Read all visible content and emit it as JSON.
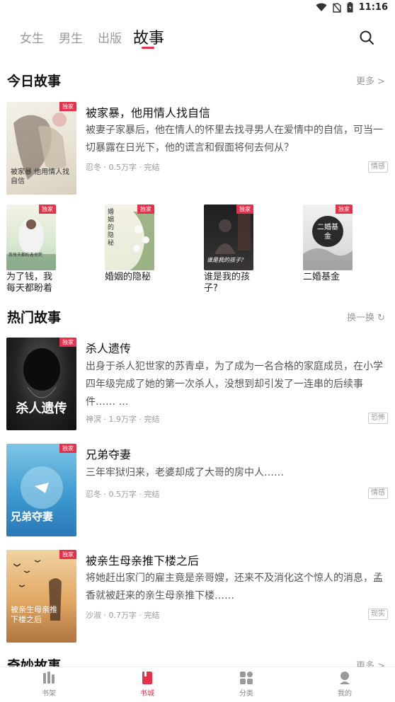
{
  "status_bar": {
    "time": "11:16"
  },
  "top_nav": {
    "tabs": [
      {
        "label": "女生"
      },
      {
        "label": "男生"
      },
      {
        "label": "出版"
      },
      {
        "label": "故事",
        "active": true
      }
    ]
  },
  "sections": {
    "today": {
      "title": "今日故事",
      "action": "更多 >"
    },
    "hot": {
      "title": "热门故事",
      "action": "换一换 ↻"
    },
    "wonder": {
      "title": "奇妙故事",
      "action": "更多 >"
    }
  },
  "badge_label": "独家",
  "featured": {
    "title": "被家暴，他用情人找自信",
    "desc": "被妻子家暴后，他在情人的怀里去找寻男人在爱情中的自信，可当一切暴露在日光下，他的谎言和假面将何去何从？",
    "meta": "忍冬 · 0.5万字 · 完结",
    "tag": "情感",
    "cover_text": "被家暴 他用情人找自信"
  },
  "grid_books": [
    {
      "title": "为了钱，我每天都盼着",
      "cover_text": "我每天都盼着他死"
    },
    {
      "title": "婚姻的隐秘",
      "cover_text": "婚姻的隐秘"
    },
    {
      "title": "谁是我的孩子?",
      "cover_text": "谁是我的孩子?"
    },
    {
      "title": "二婚基金",
      "cover_text": "二婚基金"
    }
  ],
  "hot_books": [
    {
      "title": "杀人遗传",
      "desc": "出身于杀人犯世家的苏青卓，为了成为一名合格的家庭成员，在小学四年级完成了她的第一次杀人，没想到却引发了一连串的后续事件…… …",
      "meta": "神溟 · 1.9万字 · 完结",
      "tag": "恐怖",
      "cover_text": "杀人遗传"
    },
    {
      "title": "兄弟夺妻",
      "desc": "三年牢狱归来，老婆却成了大哥的房中人……",
      "meta": "忍冬 · 0.5万字 · 完结",
      "tag": "情感",
      "cover_text": "兄弟夺妻"
    },
    {
      "title": "被亲生母亲推下楼之后",
      "desc": "将她赶出家门的雇主竟是亲哥嫂，还来不及消化这个惊人的消息，孟香就被赶来的亲生母亲推下楼……",
      "meta": "沙淑 · 0.7万字 · 完结",
      "tag": "现实",
      "cover_text": "被亲生母亲推下楼之后"
    }
  ],
  "bottom_nav": [
    {
      "label": "书架",
      "icon": "bookshelf-icon"
    },
    {
      "label": "书城",
      "icon": "bookstore-icon",
      "active": true
    },
    {
      "label": "分类",
      "icon": "category-icon"
    },
    {
      "label": "我的",
      "icon": "profile-icon"
    }
  ],
  "colors": {
    "accent": "#e8304a"
  }
}
